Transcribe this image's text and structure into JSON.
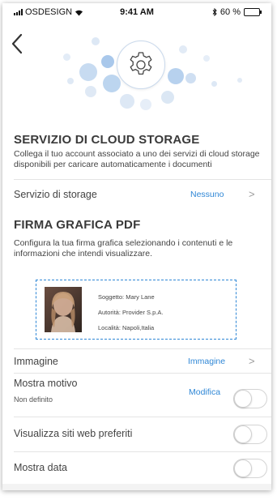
{
  "status_bar": {
    "carrier": "OSDESIGN",
    "time": "9:41 AM",
    "battery": "60 %",
    "battery_level": 0.6
  },
  "cloud": {
    "title": "SERVIZIO DI CLOUD STORAGE",
    "description": "Collega il tuo account associato a uno dei servizi di cloud storage disponibili per caricare automaticamente i documenti",
    "storage_label": "Servizio di storage",
    "storage_value": "Nessuno"
  },
  "firma": {
    "title": "FIRMA GRAFICA PDF",
    "description": "Configura la tua firma grafica selezionando i contenuti e le informazioni che intendi visualizzare.",
    "signature": {
      "subject": "Soggetto: Mary Lane",
      "authority": "Autorità: Provider S.p.A.",
      "locality": "Località: Napoli,Italia"
    }
  },
  "settings": {
    "image_label": "Immagine",
    "image_value": "Immagine",
    "motivo_label": "Mostra motivo",
    "motivo_sub": "Non definito",
    "motivo_action": "Modifica",
    "sites_label": "Visualizza siti web preferiti",
    "date_label": "Mostra data"
  },
  "toggles": {
    "motivo": false,
    "sites": false,
    "date": false
  },
  "icons": {
    "back": "chevron-left-icon",
    "gear": "gear-icon",
    "chevron": "chevron-right-icon"
  },
  "colors": {
    "accent": "#2f87d6",
    "text": "#3a3a3a",
    "dots": "#cfe0f3"
  }
}
